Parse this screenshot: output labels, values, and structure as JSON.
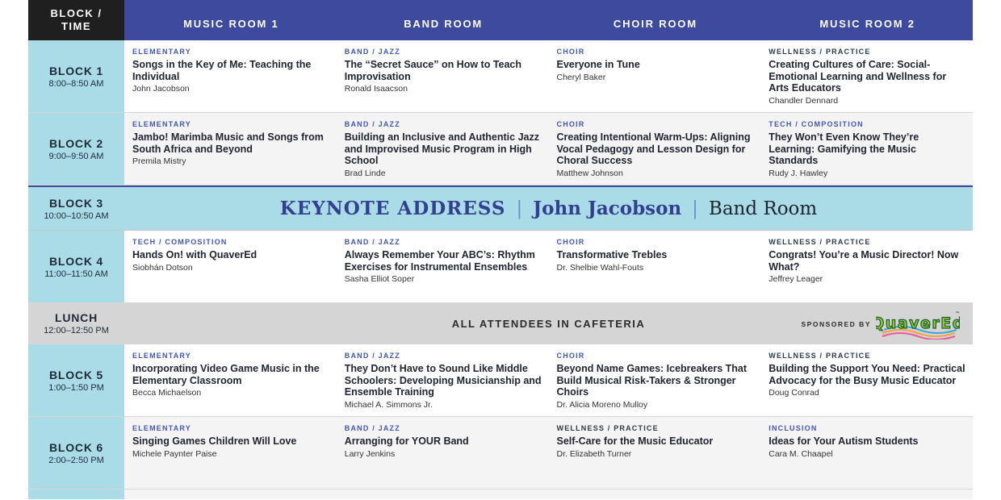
{
  "header": {
    "block_time": "BLOCK /\nTIME",
    "rooms": [
      "MUSIC ROOM 1",
      "BAND ROOM",
      "CHOIR ROOM",
      "MUSIC ROOM 2"
    ]
  },
  "blocks": [
    {
      "name": "BLOCK 1",
      "time": "8:00–8:50 AM",
      "sessions": [
        {
          "category": "ELEMENTARY",
          "title": "Songs in the Key of Me: Teaching the Individual",
          "speaker": "John Jacobson"
        },
        {
          "category": "BAND / JAZZ",
          "title": "The “Secret Sauce” on How to Teach Improvisation",
          "speaker": "Ronald Isaacson"
        },
        {
          "category": "CHOIR",
          "title": "Everyone in Tune",
          "speaker": "Cheryl Baker"
        },
        {
          "category": "WELLNESS / PRACTICE",
          "title": "Creating Cultures of Care: Social-Emotional Learning and Wellness for Arts Educators",
          "speaker": "Chandler Dennard"
        }
      ]
    },
    {
      "name": "BLOCK 2",
      "time": "9:00–9:50 AM",
      "sessions": [
        {
          "category": "ELEMENTARY",
          "title": "Jambo! Marimba Music and Songs from South Africa and Beyond",
          "speaker": "Premila Mistry"
        },
        {
          "category": "BAND / JAZZ",
          "title": "Building an Inclusive and Authentic Jazz and Improvised Music Program in High School",
          "speaker": "Brad Linde"
        },
        {
          "category": "CHOIR",
          "title": "Creating Intentional Warm-Ups: Aligning Vocal Pedagogy and Lesson Design for Choral Success",
          "speaker": "Matthew Johnson"
        },
        {
          "category": "TECH / COMPOSITION",
          "title": "They Won’t Even Know They’re Learning: Gamifying the Music Standards",
          "speaker": "Rudy J. Hawley"
        }
      ]
    },
    {
      "name": "BLOCK 4",
      "time": "11:00–11:50 AM",
      "sessions": [
        {
          "category": "TECH / COMPOSITION",
          "title": "Hands On! with QuaverEd",
          "speaker": "Siobhán Dotson"
        },
        {
          "category": "BAND / JAZZ",
          "title": "Always Remember Your ABC’s: Rhythm Exercises for Instrumental Ensembles",
          "speaker": "Sasha Elliot Soper"
        },
        {
          "category": "CHOIR",
          "title": "Transformative Trebles",
          "speaker": "Dr. Shelbie Wahl-Fouts"
        },
        {
          "category": "WELLNESS / PRACTICE",
          "title": "Congrats! You’re a Music Director! Now What?",
          "speaker": "Jeffrey Leager"
        }
      ]
    },
    {
      "name": "BLOCK 5",
      "time": "1:00–1:50 PM",
      "sessions": [
        {
          "category": "ELEMENTARY",
          "title": "Incorporating Video Game Music in the Elementary Classroom",
          "speaker": "Becca Michaelson"
        },
        {
          "category": "BAND / JAZZ",
          "title": "They Don’t Have to Sound Like Middle Schoolers: Developing Musicianship and Ensemble Training",
          "speaker": "Michael A. Simmons Jr."
        },
        {
          "category": "CHOIR",
          "title": "Beyond Name Games: Icebreakers That Build Musical Risk-Takers & Stronger Choirs",
          "speaker": "Dr. Alicia Moreno Mulloy"
        },
        {
          "category": "WELLNESS / PRACTICE",
          "title": "Building the Support You Need: Practical Advocacy for the Busy Music Educator",
          "speaker": "Doug Conrad"
        }
      ]
    },
    {
      "name": "BLOCK 6",
      "time": "2:00–2:50 PM",
      "sessions": [
        {
          "category": "ELEMENTARY",
          "title": "Singing Games Children Will Love",
          "speaker": "Michele Paynter Paise"
        },
        {
          "category": "BAND / JAZZ",
          "title": "Arranging for YOUR Band",
          "speaker": "Larry Jenkins"
        },
        {
          "category": "WELLNESS / PRACTICE",
          "title": "Self-Care for the Music Educator",
          "speaker": "Dr. Elizabeth Turner"
        },
        {
          "category": "INCLUSION",
          "title": "Ideas for Your Autism Students",
          "speaker": "Cara M. Chaapel"
        }
      ]
    }
  ],
  "keynote": {
    "name": "BLOCK 3",
    "time": "10:00–10:50 AM",
    "label": "KEYNOTE ADDRESS",
    "separator": "|",
    "speaker": "John Jacobson",
    "room": "Band Room"
  },
  "lunch": {
    "name": "LUNCH",
    "time": "12:00–12:50 PM",
    "text": "ALL ATTENDEES IN CAFETERIA",
    "sponsored_by": "SPONSORED BY",
    "sponsor_logo": "QuaverEd",
    "sponsor_trademark": "™"
  },
  "colors": {
    "header_blue": "#3e4a9e",
    "time_cyan": "#a9dce6",
    "category_blue": "#4356b3",
    "lunch_gray": "#d5d5d5",
    "logo_green": "#8cc63f"
  }
}
